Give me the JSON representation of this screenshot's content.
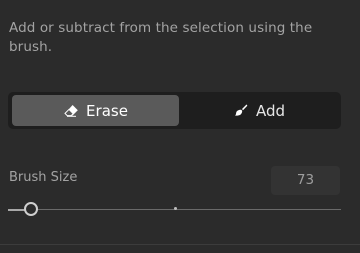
{
  "description": "Add or subtract from the selection using the brush.",
  "mode_toggle": {
    "options": [
      {
        "label": "Erase",
        "icon": "eraser-icon",
        "active": true
      },
      {
        "label": "Add",
        "icon": "brush-icon",
        "active": false
      }
    ]
  },
  "brush_size": {
    "label": "Brush Size",
    "value": "73",
    "slider_fraction": 0.07
  },
  "colors": {
    "background": "#2b2b2b",
    "toggle_bg": "#1e1e1e",
    "active_btn": "#5a5a5a",
    "text_muted": "#a3a3a3"
  }
}
